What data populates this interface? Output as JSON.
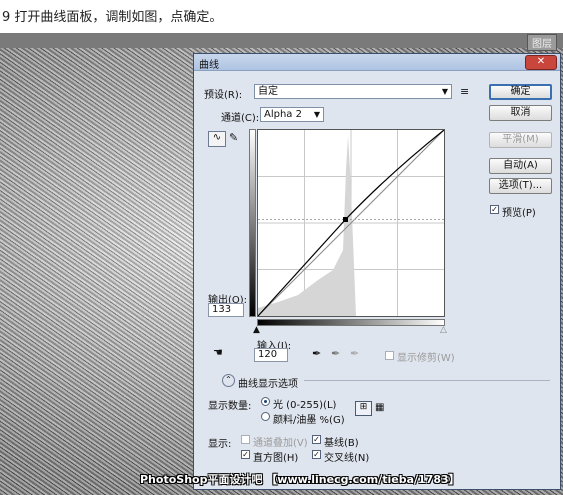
{
  "caption": "9 打开曲线面板，调制如图，点确定。",
  "ps_tab": "图层",
  "dialog": {
    "title": "曲线",
    "preset_label": "预设(R):",
    "preset_value": "自定",
    "channel_label": "通道(C):",
    "channel_value": "Alpha 2",
    "buttons": {
      "ok": "确定",
      "cancel": "取消",
      "smooth": "平滑(M)",
      "auto": "自动(A)",
      "options": "选项(T)..."
    },
    "preview_label": "预览(P)",
    "preview_checked": true,
    "output_label": "输出(O):",
    "output_value": "133",
    "input_label": "输入(I):",
    "input_value": "120",
    "show_clipping_label": "显示修剪(W)",
    "curve_display_options_label": "曲线显示选项",
    "show_amount_label": "显示数量:",
    "light_option": "光 (0-255)(L)",
    "pigment_option": "颜料/油墨 %(G)",
    "show_label": "显示:",
    "channel_overlays": "通道叠加(V)",
    "baseline": "基线(B)",
    "histogram": "直方图(H)",
    "intersection_line": "交叉线(N)",
    "checks": {
      "channel_overlays": false,
      "baseline": true,
      "histogram": true,
      "intersection_line": true
    },
    "curve_point": {
      "input": 120,
      "output": 133
    }
  },
  "watermark": "PhotoShop平面设计吧 【www.linecg.com/tieba/1783】",
  "icons": {
    "preset_menu": "menu-lines-icon",
    "curve_tool": "curve-tool-icon",
    "pencil_tool": "pencil-icon",
    "hand_tool": "on-image-adjust-icon",
    "eyedroppers": [
      "black-eyedropper-icon",
      "gray-eyedropper-icon",
      "white-eyedropper-icon"
    ]
  }
}
